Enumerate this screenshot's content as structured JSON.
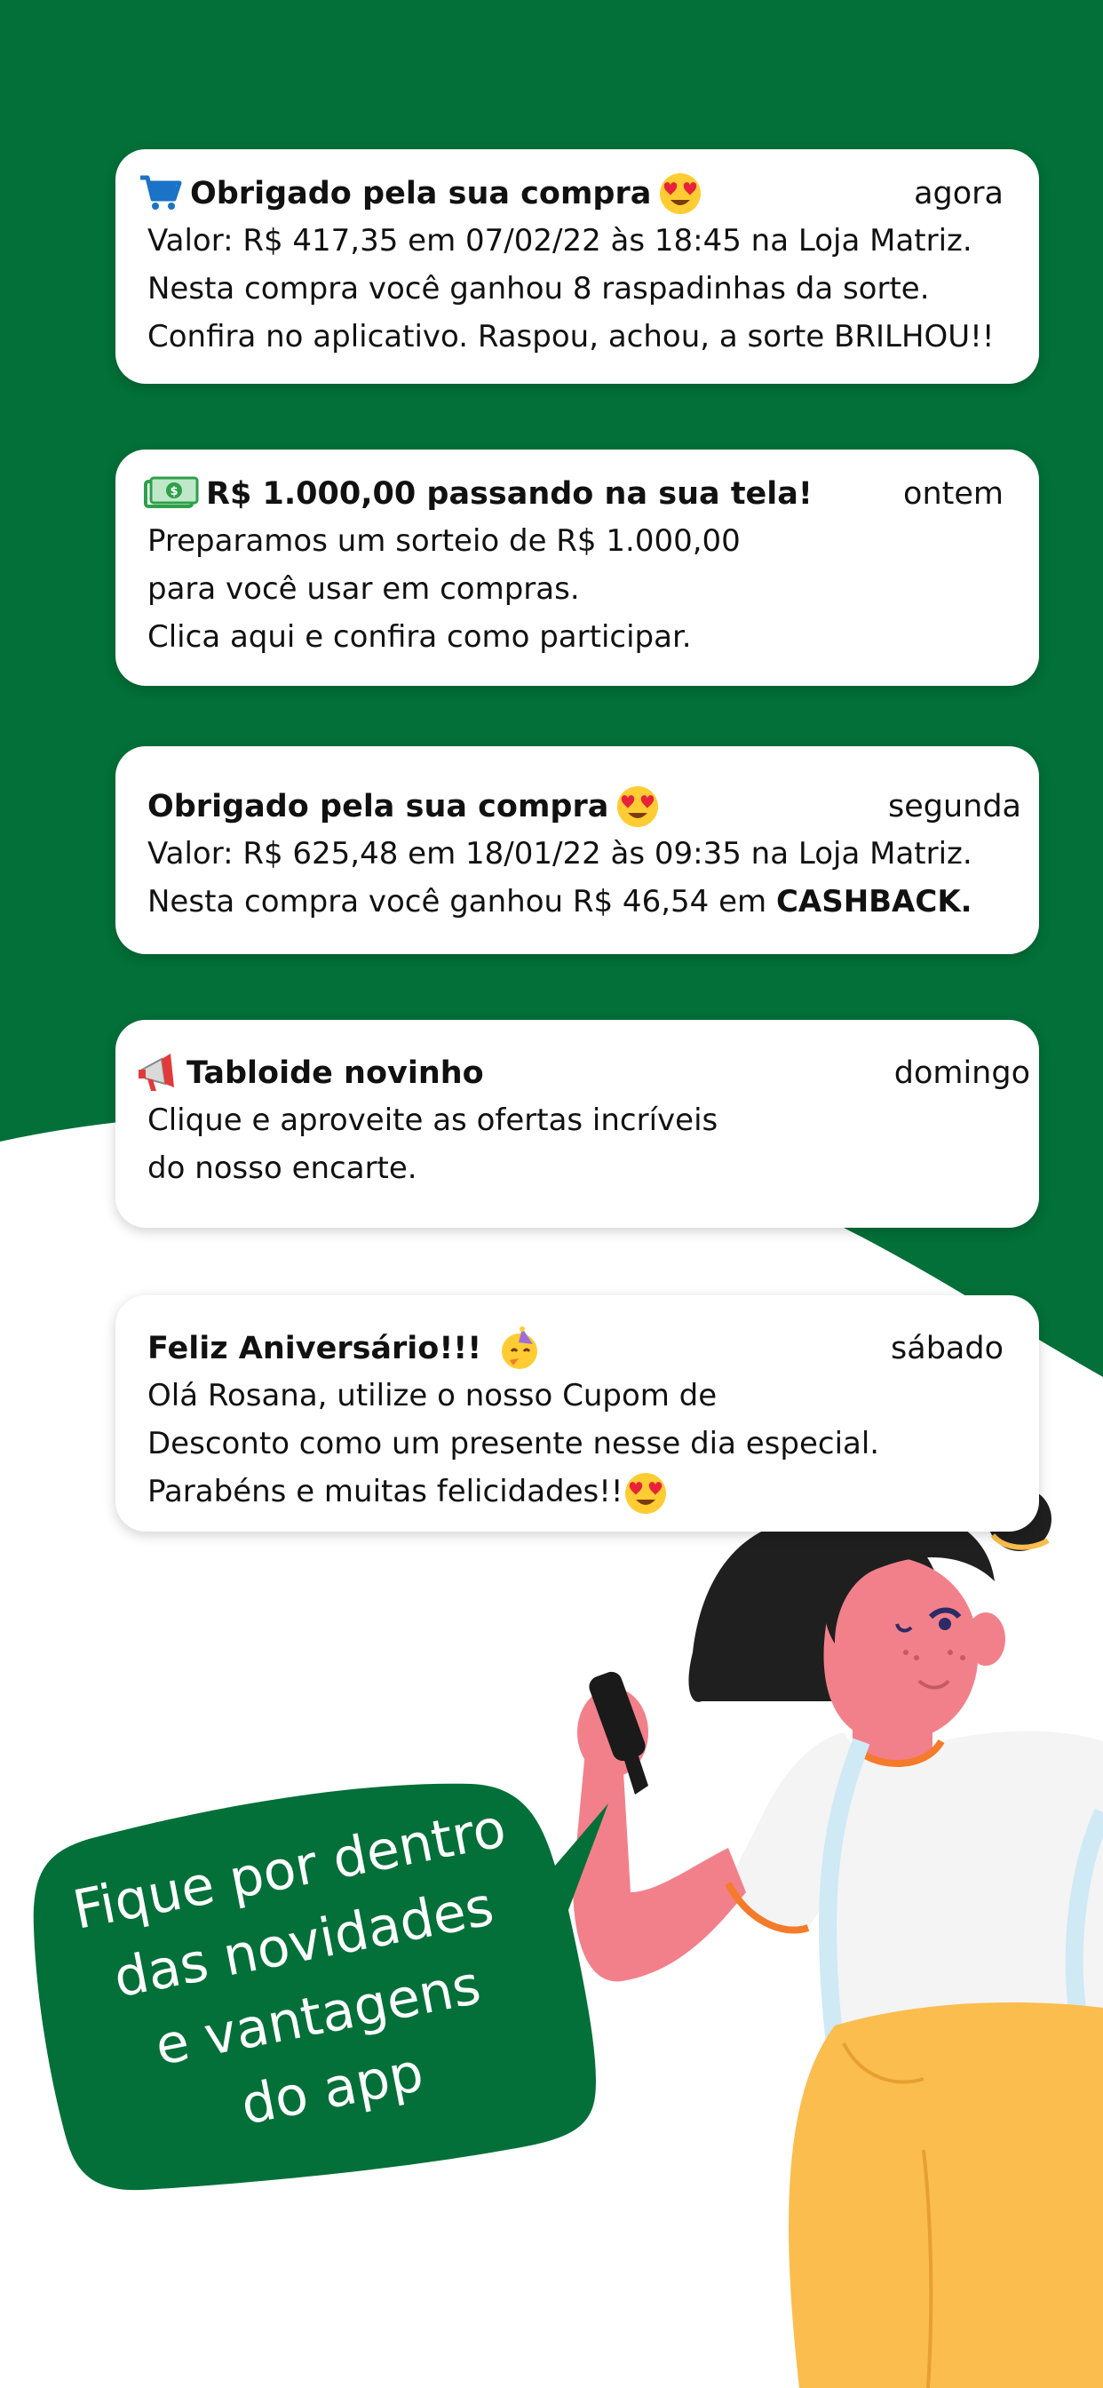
{
  "colors": {
    "green": "#027038",
    "white": "#ffffff",
    "yellow": "#fbbd4d",
    "skin": "#f2808a"
  },
  "notifications": [
    {
      "icon": "shopping-cart-icon",
      "title": "Obrigado pela sua compra",
      "title_emoji": "heart-eyes-emoji",
      "time": "agora",
      "lines": [
        "Valor: R$ 417,35 em 07/02/22 às 18:45 na Loja Matriz.",
        "Nesta compra você ganhou 8 raspadinhas da sorte.",
        "Confira no aplicativo. Raspou, achou, a sorte BRILHOU!!"
      ]
    },
    {
      "icon": "money-bill-icon",
      "title": "R$ 1.000,00 passando na sua tela!",
      "time": "ontem",
      "lines": [
        "Preparamos um sorteio de R$ 1.000,00",
        "para você usar em compras.",
        "Clica aqui e confira como participar."
      ]
    },
    {
      "title": "Obrigado pela sua compra",
      "title_emoji": "heart-eyes-emoji",
      "time": "segunda",
      "lines": [
        "Valor: R$ 625,48 em 18/01/22 às 09:35 na Loja Matriz."
      ],
      "line_plain": "Nesta compra você ganhou R$ 46,54 em ",
      "line_bold": "CASHBACK."
    },
    {
      "icon": "megaphone-icon",
      "title": "Tabloide novinho",
      "time": "domingo",
      "lines": [
        "Clique e aproveite as ofertas incríveis",
        "do nosso encarte."
      ]
    },
    {
      "title": "Feliz Aniversário!!!",
      "title_emoji": "party-face-emoji",
      "time": "sábado",
      "lines": [
        "Olá Rosana, utilize o nosso Cupom de",
        "Desconto como um presente nesse dia especial."
      ],
      "last_line": "Parabéns e muitas felicidades!!",
      "last_emoji": "heart-eyes-emoji"
    }
  ],
  "bubble": {
    "lines": [
      "Fique por dentro",
      "das novidades",
      "e vantagens",
      "do app"
    ]
  }
}
